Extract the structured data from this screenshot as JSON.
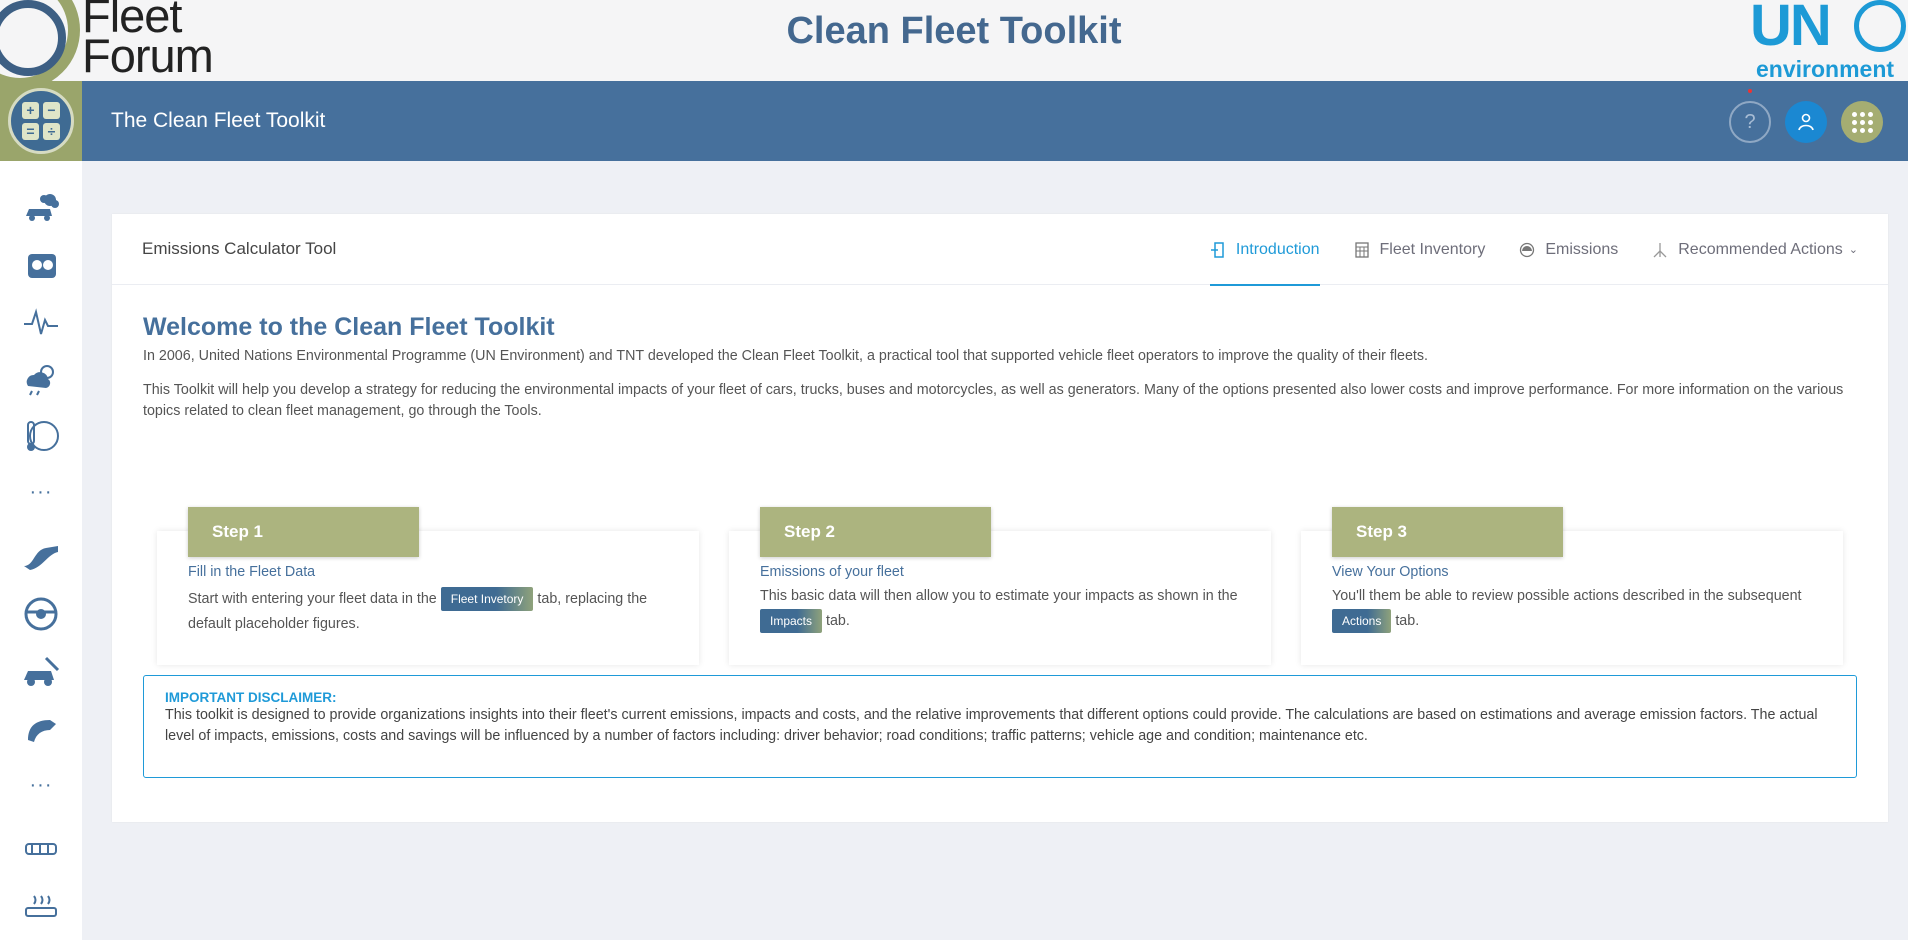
{
  "banner": {
    "left_logo_line1": "Fleet",
    "left_logo_line2": "Forum",
    "title": "Clean Fleet Toolkit",
    "right_logo_un": "UN",
    "right_logo_env": "environment"
  },
  "header": {
    "title": "The Clean Fleet Toolkit",
    "calc_symbols": [
      "+",
      "−",
      "=",
      "÷"
    ],
    "help_icon": "question-circle-icon",
    "user_icon": "user-icon",
    "apps_icon": "apps-grid-icon"
  },
  "sidebar": {
    "items": [
      {
        "icon": "car-emissions-icon"
      },
      {
        "icon": "car-dashboard-icon"
      },
      {
        "icon": "pulse-icon"
      },
      {
        "icon": "weather-icon"
      },
      {
        "icon": "globe-thermometer-icon"
      },
      {
        "more": "···"
      },
      {
        "icon": "road-icon"
      },
      {
        "icon": "steering-wheel-icon"
      },
      {
        "icon": "car-repair-icon"
      },
      {
        "icon": "fuel-nozzle-icon"
      },
      {
        "more": "···"
      },
      {
        "icon": "engine-icon"
      },
      {
        "icon": "heater-icon"
      }
    ]
  },
  "card": {
    "title": "Emissions Calculator Tool",
    "tabs": [
      {
        "label": "Introduction",
        "icon": "door-icon",
        "active": true
      },
      {
        "label": "Fleet Inventory",
        "icon": "calculator-icon",
        "active": false
      },
      {
        "label": "Emissions",
        "icon": "gauge-icon",
        "active": false
      },
      {
        "label": "Recommended Actions",
        "icon": "branch-icon",
        "active": false
      }
    ]
  },
  "intro": {
    "heading": "Welcome to the Clean Fleet Toolkit",
    "para1": "In 2006, United Nations Environmental Programme (UN Environment) and TNT developed the Clean Fleet Toolkit, a practical tool that supported vehicle fleet operators to improve the quality of their fleets.",
    "para2": "This Toolkit will help you develop a strategy for reducing the environmental impacts of your fleet of cars, trucks, buses and motorcycles, as well as generators. Many of the options presented also lower costs and improve performance. For more information on the various topics related to clean fleet management, go through the Tools."
  },
  "steps": [
    {
      "tag": "Step 1",
      "sub": "Fill in the Fleet Data",
      "before": "Start with entering your fleet data in the ",
      "pill": "Fleet Invetory",
      "after": " tab, replacing the default placeholder figures."
    },
    {
      "tag": "Step 2",
      "sub": "Emissions of your fleet",
      "before": "This basic data will then allow you to estimate your impacts as shown in the ",
      "pill": "Impacts",
      "after": " tab."
    },
    {
      "tag": "Step 3",
      "sub": "View Your Options",
      "before": "You'll them be able to review possible actions described in the subsequent ",
      "pill": "Actions",
      "after": " tab."
    }
  ],
  "disclaimer": {
    "title": "IMPORTANT DISCLAIMER",
    "colon": ":",
    "text": "This toolkit is designed to provide organizations insights into their fleet's current emissions, impacts and costs, and the relative improvements that different options could provide. The calculations are based on estimations and average emission factors. The actual level of impacts, emissions, costs and savings will be influenced by a number of factors including: driver behavior; road conditions; traffic patterns; vehicle age and condition; maintenance etc."
  },
  "colors": {
    "header_blue": "#46709c",
    "olive": "#9aa56b",
    "accent_blue": "#1f9ad8"
  }
}
